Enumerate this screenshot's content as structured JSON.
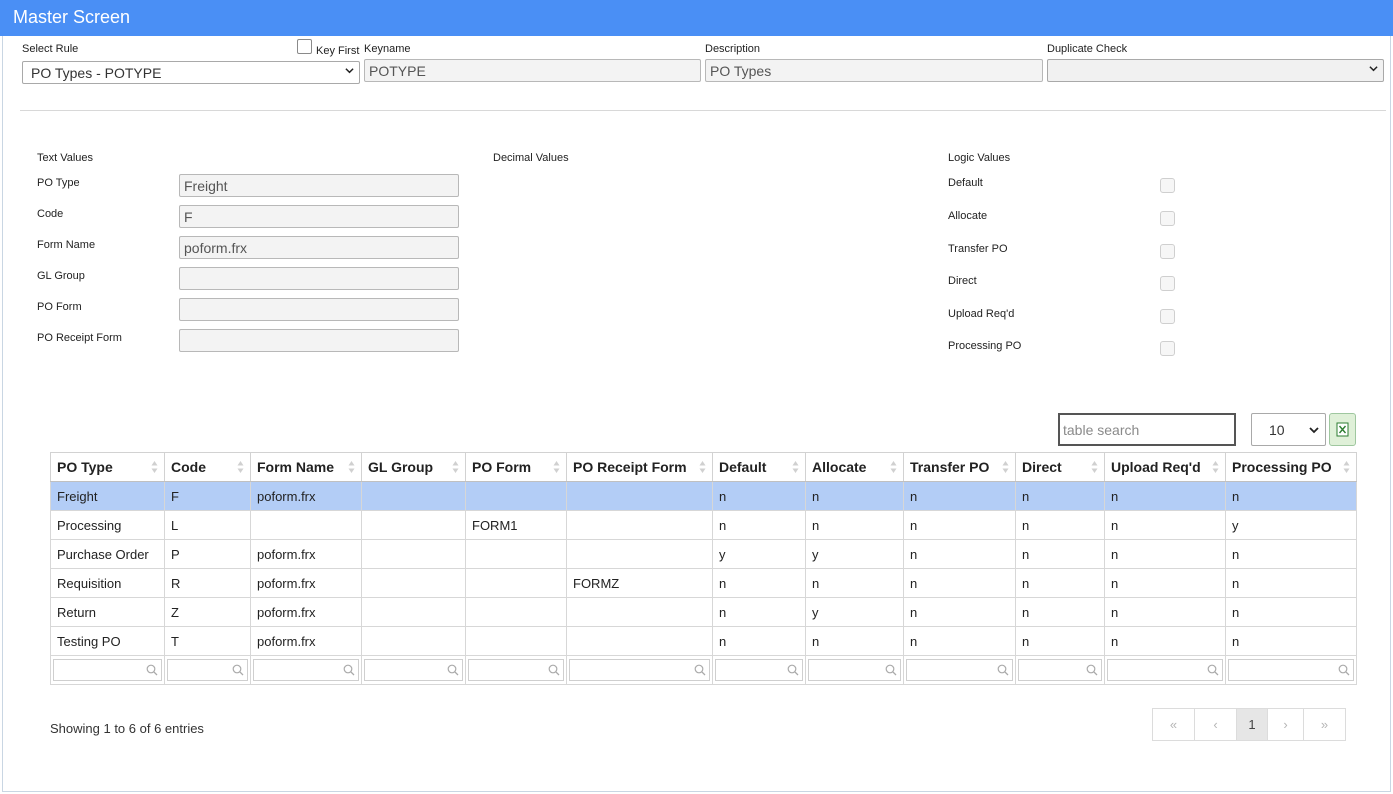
{
  "app": {
    "title": "Master Screen"
  },
  "header": {
    "select_rule_label": "Select Rule",
    "select_rule_value": "PO Types - POTYPE",
    "key_first_label": "Key First",
    "keyname_label": "Keyname",
    "keyname_value": "POTYPE",
    "description_label": "Description",
    "description_value": "PO Types",
    "duplicate_check_label": "Duplicate Check",
    "duplicate_check_value": ""
  },
  "sections": {
    "text_values": "Text Values",
    "decimal_values": "Decimal Values",
    "logic_values": "Logic Values"
  },
  "text_fields": [
    {
      "label": "PO Type",
      "value": "Freight"
    },
    {
      "label": "Code",
      "value": "F"
    },
    {
      "label": "Form Name",
      "value": "poform.frx"
    },
    {
      "label": "GL Group",
      "value": ""
    },
    {
      "label": "PO Form",
      "value": ""
    },
    {
      "label": "PO Receipt Form",
      "value": ""
    }
  ],
  "logic_fields": [
    {
      "label": "Default",
      "checked": false
    },
    {
      "label": "Allocate",
      "checked": false
    },
    {
      "label": "Transfer PO",
      "checked": false
    },
    {
      "label": "Direct",
      "checked": false
    },
    {
      "label": "Upload Req'd",
      "checked": false
    },
    {
      "label": "Processing PO",
      "checked": false
    }
  ],
  "table_controls": {
    "search_placeholder": "table search",
    "page_length": "10",
    "export_icon": "excel-icon"
  },
  "table": {
    "columns": [
      "PO Type",
      "Code",
      "Form Name",
      "GL Group",
      "PO Form",
      "PO Receipt Form",
      "Default",
      "Allocate",
      "Transfer PO",
      "Direct",
      "Upload Req'd",
      "Processing PO"
    ],
    "selected_row": 0,
    "rows": [
      [
        "Freight",
        "F",
        "poform.frx",
        "",
        "",
        "",
        "n",
        "n",
        "n",
        "n",
        "n",
        "n"
      ],
      [
        "Processing",
        "L",
        "",
        "",
        "FORM1",
        "",
        "n",
        "n",
        "n",
        "n",
        "n",
        "y"
      ],
      [
        "Purchase Order",
        "P",
        "poform.frx",
        "",
        "",
        "",
        "y",
        "y",
        "n",
        "n",
        "n",
        "n"
      ],
      [
        "Requisition",
        "R",
        "poform.frx",
        "",
        "",
        "FORMZ",
        "n",
        "n",
        "n",
        "n",
        "n",
        "n"
      ],
      [
        "Return",
        "Z",
        "poform.frx",
        "",
        "",
        "",
        "n",
        "y",
        "n",
        "n",
        "n",
        "n"
      ],
      [
        "Testing PO",
        "T",
        "poform.frx",
        "",
        "",
        "",
        "n",
        "n",
        "n",
        "n",
        "n",
        "n"
      ]
    ]
  },
  "footer": {
    "info": "Showing 1 to 6 of 6 entries",
    "pager": {
      "first": "«",
      "prev": "‹",
      "current": "1",
      "next": "›",
      "last": "»"
    }
  },
  "colors": {
    "titlebar": "#4a8ff5",
    "selected_row": "#b3cdf6",
    "excel_button": "#dff0d8"
  }
}
